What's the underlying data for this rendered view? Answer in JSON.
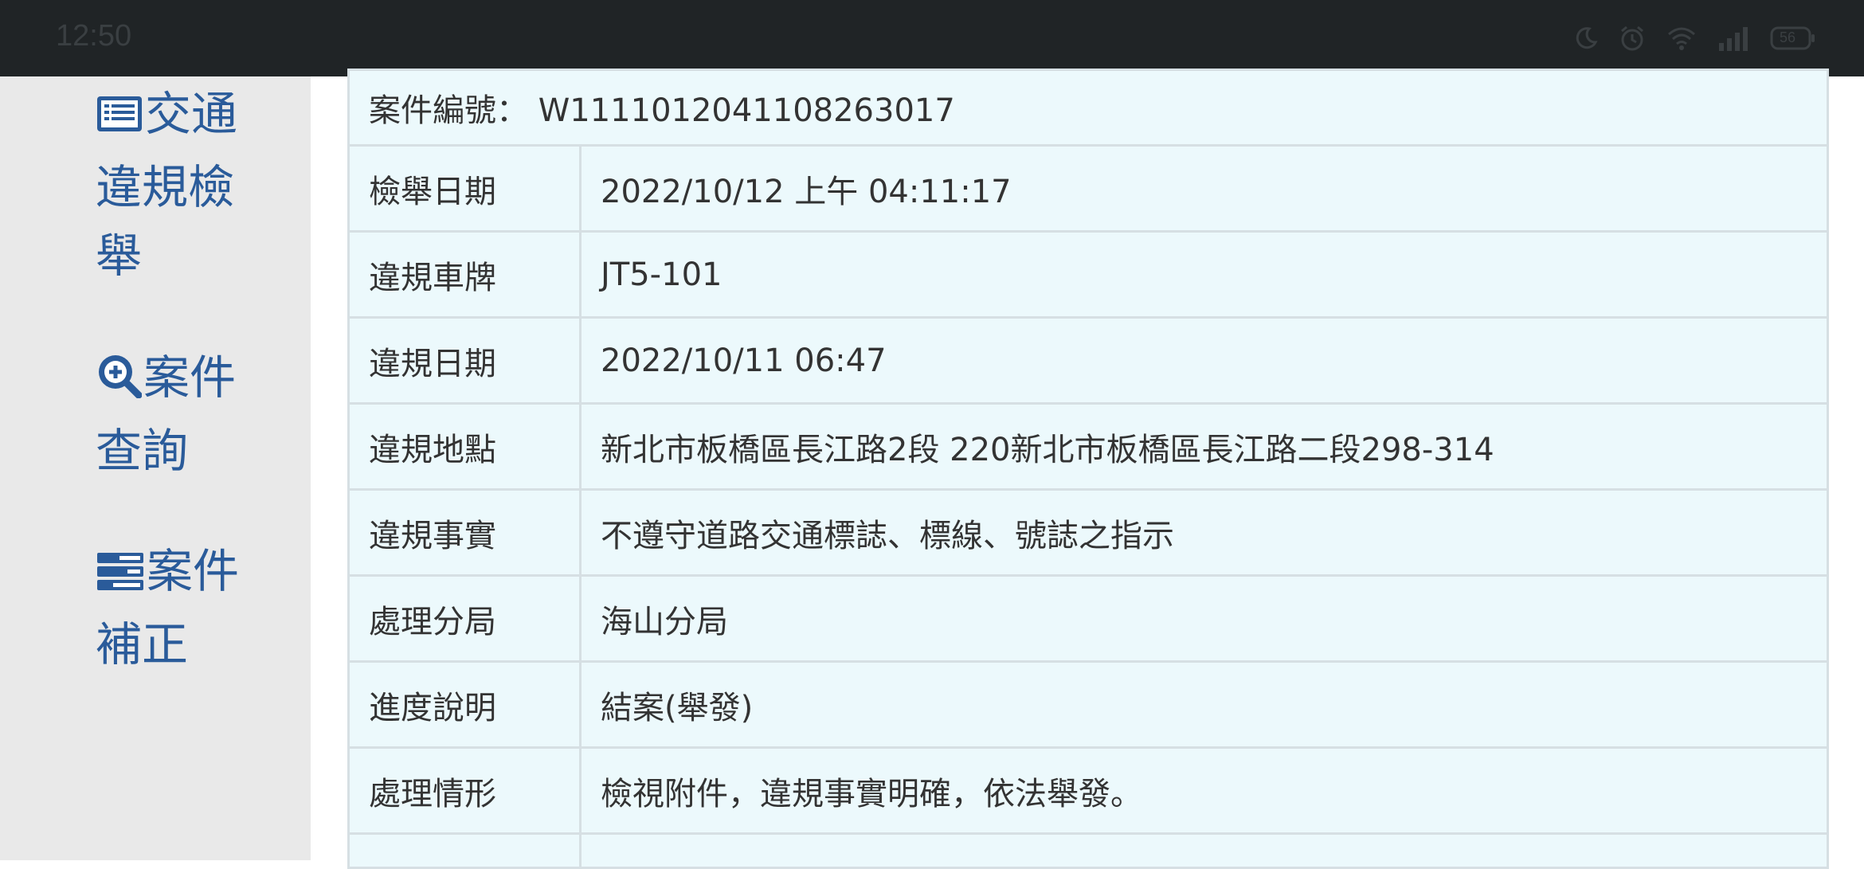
{
  "status_bar": {
    "time": "12:50",
    "battery": "56",
    "icons": [
      "moon-icon",
      "alarm-icon",
      "wifi-icon",
      "signal-icon",
      "battery-icon"
    ]
  },
  "sidebar": {
    "items": [
      {
        "label": "交通違規檢舉",
        "icon": "list-icon"
      },
      {
        "label": "案件查詢",
        "icon": "zoom-in-icon"
      },
      {
        "label": "案件補正",
        "icon": "tasks-icon"
      }
    ]
  },
  "case": {
    "number_label": "案件編號：",
    "number_value": "W1111012041108263017",
    "rows": [
      {
        "label": "檢舉日期",
        "value": "2022/10/12 上午 04:11:17"
      },
      {
        "label": "違規車牌",
        "value": "JT5-101"
      },
      {
        "label": "違規日期",
        "value": "2022/10/11 06:47"
      },
      {
        "label": "違規地點",
        "value": "新北市板橋區長江路2段 220新北市板橋區長江路二段298-314"
      },
      {
        "label": "違規事實",
        "value": "不遵守道路交通標誌、標線、號誌之指示"
      },
      {
        "label": "處理分局",
        "value": "海山分局"
      },
      {
        "label": "進度說明",
        "value": "結案(舉發)"
      },
      {
        "label": "處理情形",
        "value": "檢視附件，違規事實明確，依法舉發。"
      }
    ]
  },
  "colors": {
    "status_bar_bg": "#202426",
    "sidebar_bg": "#e9e9e9",
    "nav_text": "#2a5b9a",
    "table_bg": "#ecf9fc",
    "table_border": "#d6dfe3"
  }
}
